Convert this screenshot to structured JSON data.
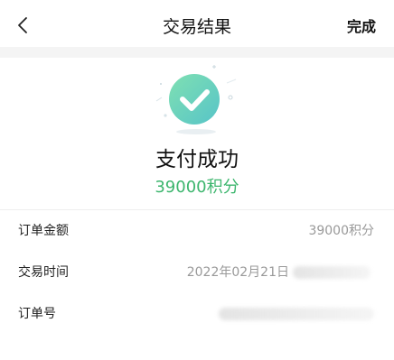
{
  "nav": {
    "title": "交易结果",
    "done_label": "完成"
  },
  "result": {
    "status": "支付成功",
    "amount": "39000积分",
    "accent_color": "#3db66e",
    "icon": "check-circle-icon"
  },
  "details": [
    {
      "label": "订单金额",
      "value": "39000积分"
    },
    {
      "label": "交易时间",
      "value": "2022年02月21日"
    },
    {
      "label": "订单号",
      "value": ""
    }
  ]
}
